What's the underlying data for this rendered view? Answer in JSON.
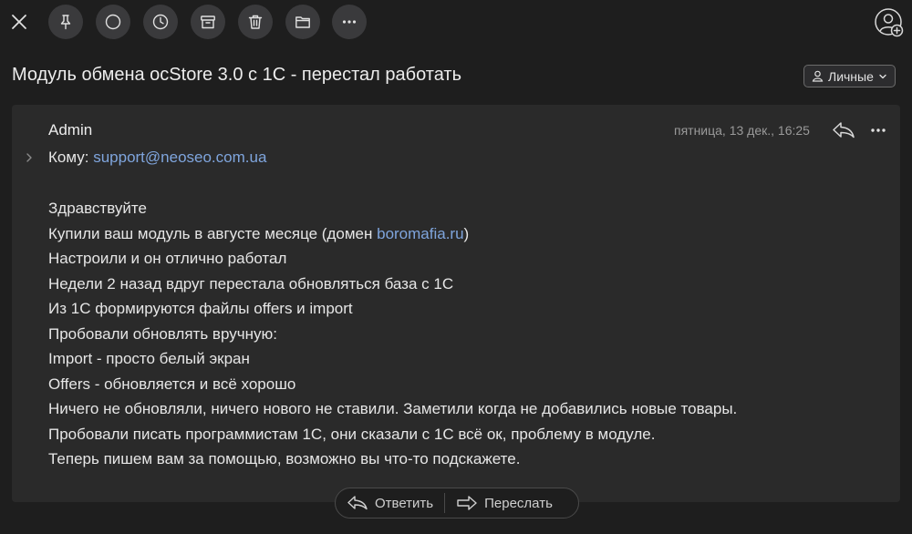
{
  "toolbar": {
    "icons": [
      "close-icon",
      "pin-icon",
      "circle-icon",
      "clock-icon",
      "archive-icon",
      "trash-icon",
      "folder-icon",
      "more-icon",
      "account-add-icon"
    ]
  },
  "message": {
    "subject": "Модуль обмена ocStore 3.0 с 1С - перестал работать",
    "category": "Личные",
    "sender": "Admin",
    "date": "пятница, 13 дек., 16:25",
    "to_label": "Кому:",
    "to_address": "support@neoseo.com.ua",
    "body": {
      "l1": "Здравствуйте",
      "l2_pre": "Купили ваш модуль в августе месяце (домен ",
      "l2_link": "boromafia.ru",
      "l2_post": ")",
      "l3": "Настроили и он отлично работал",
      "l4": "Недели 2 назад вдруг перестала обновляться база с 1С",
      "l5": "Из 1С формируются файлы offers и import",
      "l6": "Пробовали обновлять вручную:",
      "l7": "Import - просто белый экран",
      "l8": "Offers - обновляется и всё хорошо",
      "l9": "Ничего не обновляли, ничего нового не ставили. Заметили когда не добавились новые товары.",
      "l10": "Пробовали писать программистам 1С, они сказали с 1С всё ок, проблему в модуле.",
      "l11": "Теперь пишем вам за помощью, возможно вы что-то подскажете."
    }
  },
  "actions": {
    "reply_label": "Ответить",
    "forward_label": "Переслать"
  },
  "colors": {
    "background": "#1e1e1e",
    "card": "#2a2a2a",
    "link": "#7fa5dd",
    "button": "#3a3a3c"
  }
}
